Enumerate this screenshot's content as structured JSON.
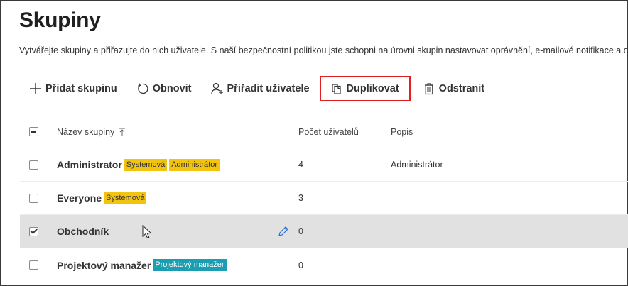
{
  "page": {
    "title": "Skupiny",
    "description": "Vytvářejte skupiny a přiřazujte do nich uživatele. S naší bezpečnostní politikou jste schopni na úrovni skupin nastavovat oprávnění, e-mailové notifikace a další."
  },
  "toolbar": {
    "add_label": "Přidat skupinu",
    "refresh_label": "Obnovit",
    "assign_label": "Přiřadit uživatele",
    "duplicate_label": "Duplikovat",
    "delete_label": "Odstranit"
  },
  "table": {
    "headers": {
      "name": "Název skupiny",
      "count": "Počet uživatelů",
      "description": "Popis"
    },
    "rows": [
      {
        "name": "Administrator",
        "badges": [
          "Systemová",
          "Administrátor"
        ],
        "count": "4",
        "description": "Administrátor",
        "selected": false
      },
      {
        "name": "Everyone",
        "badges": [
          "Systemová"
        ],
        "count": "3",
        "description": "",
        "selected": false
      },
      {
        "name": "Obchodník",
        "badges": [],
        "count": "0",
        "description": "",
        "selected": true
      },
      {
        "name": "Projektový manažer",
        "badges": [
          "Projektový manažer"
        ],
        "count": "0",
        "description": "",
        "selected": false
      }
    ]
  },
  "colors": {
    "badge_system": "#f2c410",
    "badge_role": "#1c9eb2",
    "highlight_border": "#e02020",
    "selected_row": "#e1e1e1",
    "edit_icon": "#2b6cc4"
  }
}
